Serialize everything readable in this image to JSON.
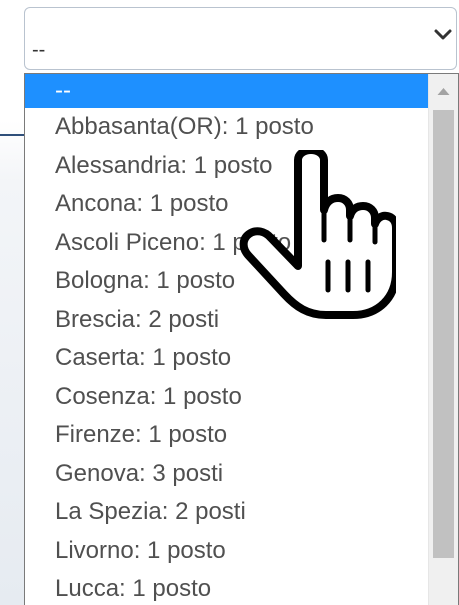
{
  "select": {
    "value": "--",
    "chevron_icon": "chevron-down-icon"
  },
  "dropdown": {
    "options": [
      {
        "label": "--",
        "selected": true
      },
      {
        "label": "Abbasanta(OR): 1 posto",
        "selected": false
      },
      {
        "label": "Alessandria: 1 posto",
        "selected": false
      },
      {
        "label": "Ancona: 1 posto",
        "selected": false
      },
      {
        "label": "Ascoli Piceno: 1 posto",
        "selected": false
      },
      {
        "label": "Bologna: 1 posto",
        "selected": false
      },
      {
        "label": "Brescia: 2 posti",
        "selected": false
      },
      {
        "label": "Caserta: 1 posto",
        "selected": false
      },
      {
        "label": "Cosenza: 1 posto",
        "selected": false
      },
      {
        "label": "Firenze: 1 posto",
        "selected": false
      },
      {
        "label": "Genova: 3 posti",
        "selected": false
      },
      {
        "label": "La Spezia: 2 posti",
        "selected": false
      },
      {
        "label": "Livorno: 1 posto",
        "selected": false
      },
      {
        "label": "Lucca: 1 posto",
        "selected": false
      }
    ],
    "selected_color": "#1e90ff",
    "scroll_up_icon": "scroll-up-arrow-icon"
  },
  "cursor": {
    "icon": "hand-pointer-icon"
  }
}
